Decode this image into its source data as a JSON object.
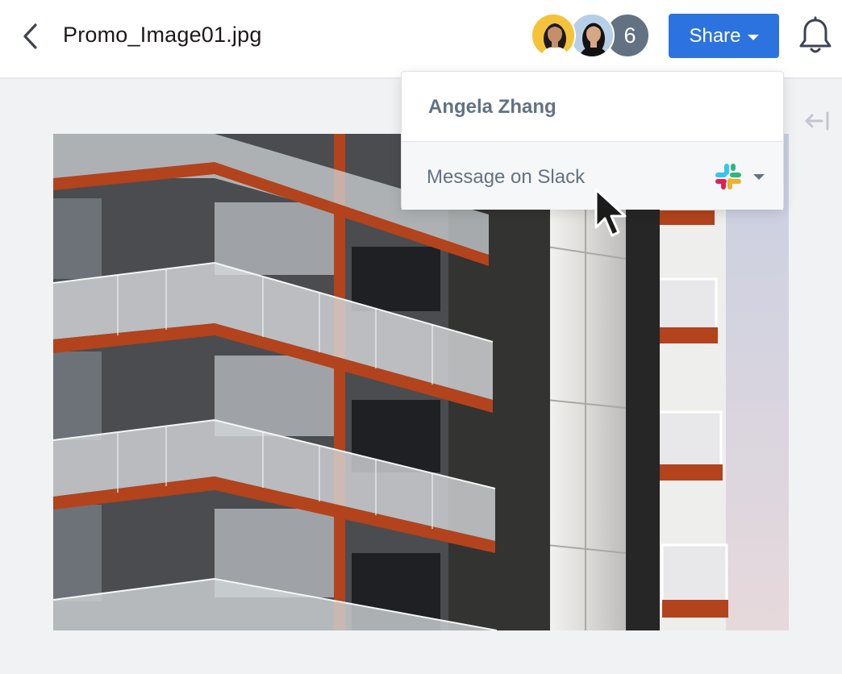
{
  "header": {
    "back_icon": "chevron-left-icon",
    "file_name": "Promo_Image01.jpg",
    "collaborators": {
      "avatars": [
        "avatar-woman-yellow",
        "avatar-woman-blue"
      ],
      "extra_count": "6"
    },
    "share_label": "Share",
    "notifications_icon": "bell-icon"
  },
  "popover": {
    "user_name": "Angela Zhang",
    "action_label": "Message on Slack",
    "action_icon": "slack-icon"
  },
  "sidebar_toggle_icon": "collapse-right-panel-icon",
  "preview": {
    "image_subject": "modern apartment building with glass balconies"
  },
  "colors": {
    "accent": "#2d73e0",
    "text_muted": "#637282",
    "background": "#f1f2f4"
  }
}
